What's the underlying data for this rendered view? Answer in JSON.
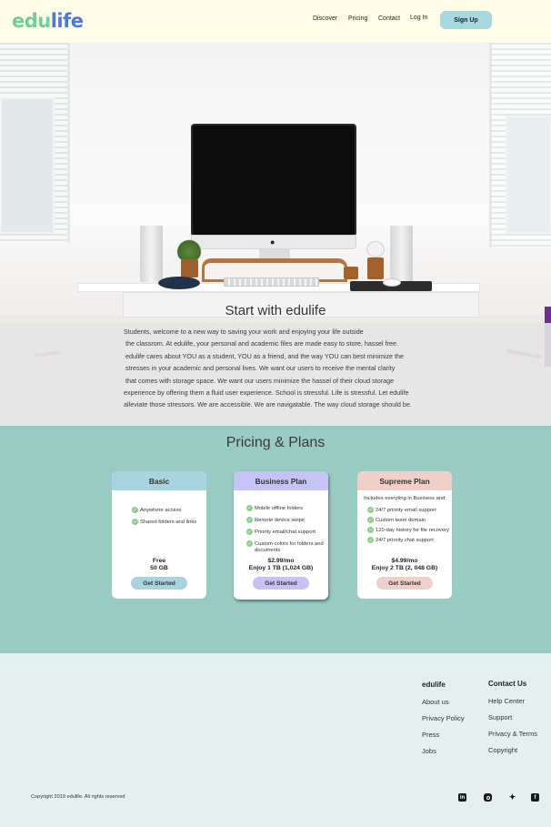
{
  "header": {
    "logo_part1": "edu",
    "logo_part2": "life",
    "nav": [
      "Discover",
      "Pricing",
      "Contact",
      "Log In"
    ],
    "signup_label": "Sign Up",
    "bg_color": "#fffde7"
  },
  "hero": {
    "title": "Start with edulife",
    "intro_lines": [
      "Students, welcome to a new way to saving your work and enjoying your life outside",
      "the classrom. At edulife, your personal and academic files are made easy to store, hassel free.",
      "edulife cares about YOU as a student, YOU as a friend, and the way YOU can best minimize the",
      "stresses in your academic and personal lives. We want our users to receive the mental clarity",
      "that comes with storage space. We want our users minimize the hassel of their cloud storage",
      "experience by offering them a  fluid user experience.  School is stressful. Life is stressful. Let edulife",
      "alleviate those stressors.  We are accessible. We are navigatable. The way cloud storage should be."
    ]
  },
  "pricing": {
    "title": "Pricing & Plans",
    "bg_color": "#98cbc2",
    "plans": [
      {
        "name": "Basic",
        "color": "#a9d3df",
        "intro": "",
        "features": [
          "Anywhere access",
          "Shared folders and links"
        ],
        "price": "Free",
        "storage": "50 GB",
        "cta": "Get Started"
      },
      {
        "name": "Business Plan",
        "color": "#c5c3f5",
        "intro": "",
        "features": [
          "Mobile offline folders",
          "Remote device swipe",
          "Priority email/chat support",
          "Custom colors for folders and",
          "documents"
        ],
        "price": "$2.99/mo",
        "storage": "Enjoy 1 TB (1,024 GB)",
        "cta": "Get Started"
      },
      {
        "name": "Supreme Plan",
        "color": "#f0cfc8",
        "intro": "Includes everyting in Business and:",
        "features": [
          "24/7 priority email support",
          "Custom team domain",
          "120-day history for file recovery",
          "24/7 priority chat support"
        ],
        "price": "$4.99/mo",
        "storage": "Enjoy 2 TB (2, 048 GB)",
        "cta": "Get Started"
      }
    ]
  },
  "footer": {
    "col1_title": "edulife",
    "col1_links": [
      "About us",
      "Privacy Policy",
      "Press",
      "Jobs"
    ],
    "col2_title": "Contact Us",
    "col2_links": [
      "Help Center",
      "Support",
      "Privacy & Terms",
      "Copyright"
    ],
    "copyright": "Copyright 2019 edulife. All rights reserved",
    "social_icons": [
      "linkedin-icon",
      "instagram-icon",
      "twitter-icon",
      "facebook-icon"
    ],
    "bg_color": "#e4f0f0"
  }
}
